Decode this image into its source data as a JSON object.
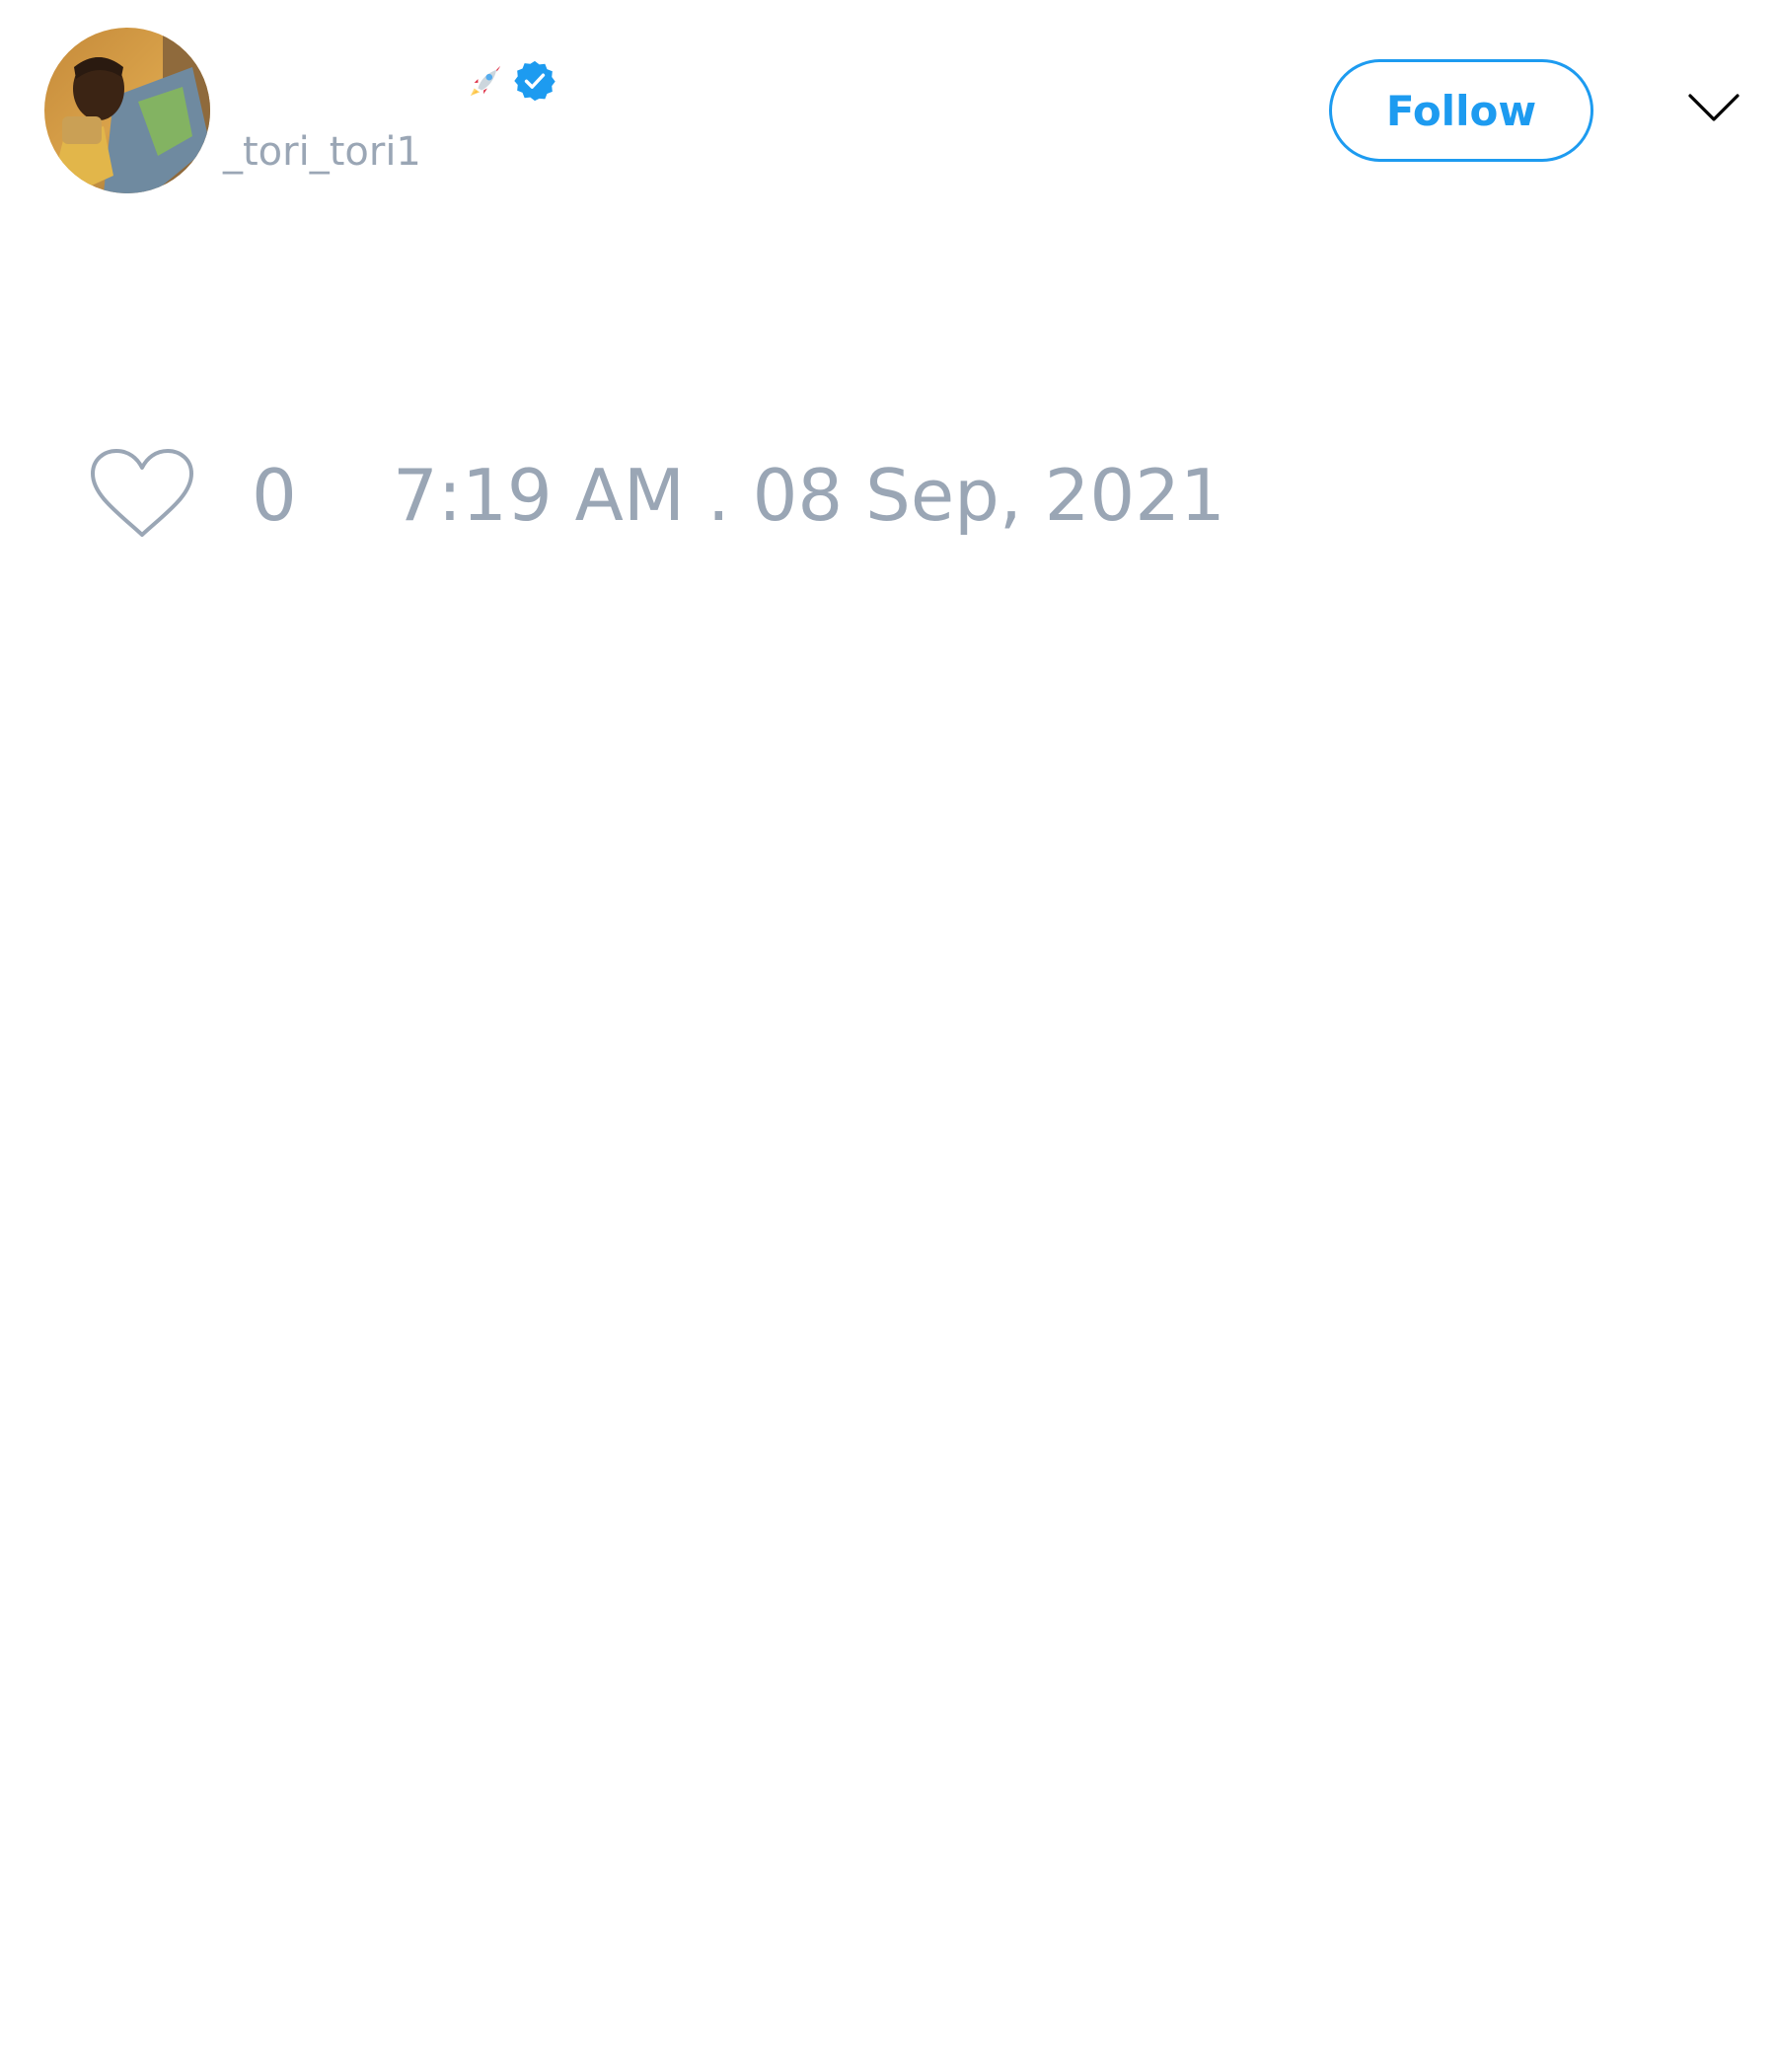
{
  "header": {
    "username": "_tori_tori1",
    "follow_label": "Follow",
    "verified": true,
    "name_emoji": "rocket-icon"
  },
  "footer": {
    "like_count": "0",
    "timestamp": "7:19 AM . 08 Sep, 2021"
  },
  "colors": {
    "accent": "#1d9bf0",
    "muted_text": "#9aa6b5"
  }
}
